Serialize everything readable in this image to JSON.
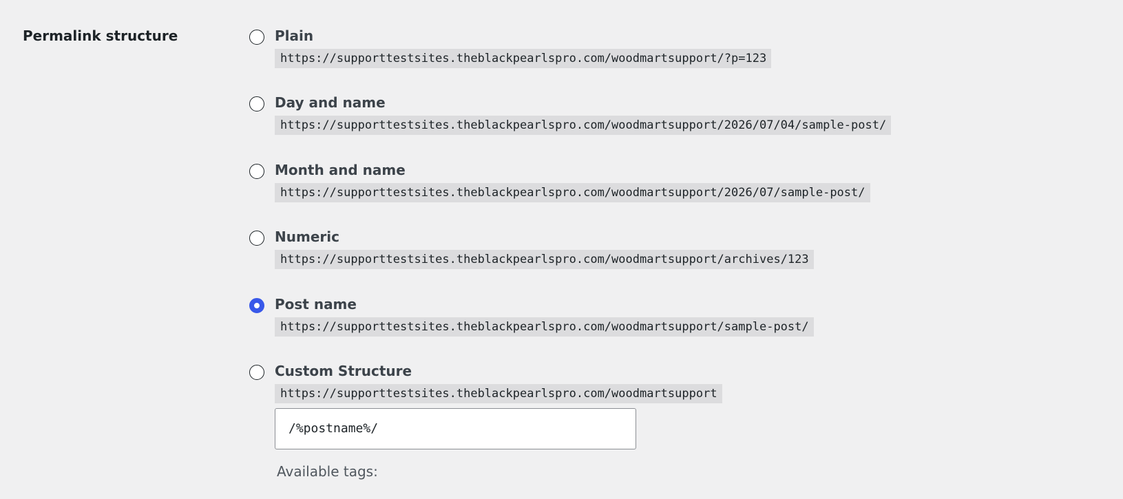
{
  "section": {
    "label": "Permalink structure"
  },
  "options": [
    {
      "label": "Plain",
      "url": "https://supporttestsites.theblackpearlspro.com/woodmartsupport/?p=123",
      "checked": false
    },
    {
      "label": "Day and name",
      "url": "https://supporttestsites.theblackpearlspro.com/woodmartsupport/2026/07/04/sample-post/",
      "checked": false
    },
    {
      "label": "Month and name",
      "url": "https://supporttestsites.theblackpearlspro.com/woodmartsupport/2026/07/sample-post/",
      "checked": false
    },
    {
      "label": "Numeric",
      "url": "https://supporttestsites.theblackpearlspro.com/woodmartsupport/archives/123",
      "checked": false
    },
    {
      "label": "Post name",
      "url": "https://supporttestsites.theblackpearlspro.com/woodmartsupport/sample-post/",
      "checked": true
    },
    {
      "label": "Custom Structure",
      "url": "https://supporttestsites.theblackpearlspro.com/woodmartsupport",
      "checked": false
    }
  ],
  "custom": {
    "value": "/%postname%/",
    "available_tags_label": "Available tags:"
  },
  "colors": {
    "accent": "#3858e9",
    "background": "#f0f0f1",
    "code_background": "#dcdcde"
  }
}
